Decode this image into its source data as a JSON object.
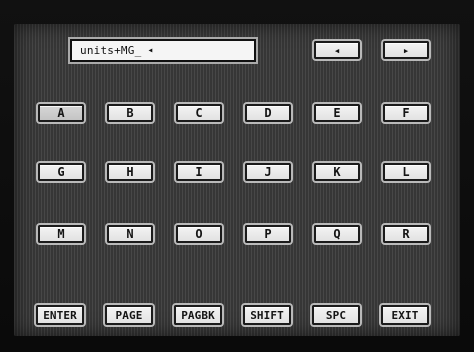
{
  "display": {
    "text": "units+MG_",
    "cursor_glyph": "◂"
  },
  "nav": {
    "left_icon": "◂",
    "right_icon": "▸"
  },
  "keys": {
    "A": "A",
    "B": "B",
    "C": "C",
    "D": "D",
    "E": "E",
    "F": "F",
    "G": "G",
    "H": "H",
    "I": "I",
    "J": "J",
    "K": "K",
    "L": "L",
    "M": "M",
    "N": "N",
    "O": "O",
    "P": "P",
    "Q": "Q",
    "R": "R"
  },
  "bottom": {
    "enter": "ENTER",
    "page": "PAGE",
    "pagbk": "PAGBK",
    "shift": "SHIFT",
    "spc": "SPC",
    "exit": "EXIT"
  },
  "selected_key": "A"
}
